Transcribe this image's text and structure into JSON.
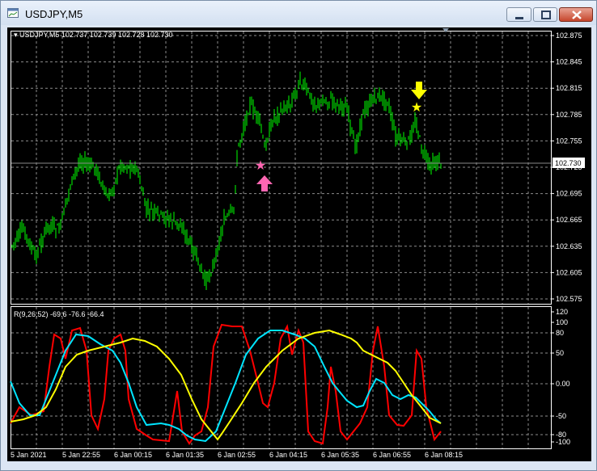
{
  "window": {
    "title": "USDJPY,M5"
  },
  "chart": {
    "header": "USDJPY,M5  102.737 102.739 102.728 102.730",
    "current_price": "102.730",
    "price_ticks": [
      "102.875",
      "102.845",
      "102.815",
      "102.785",
      "102.755",
      "102.725",
      "102.695",
      "102.665",
      "102.635",
      "102.605",
      "102.575"
    ],
    "indicator_header": "R(9,26,52) -69.6 -76.6 -66.4",
    "indicator_ticks": [
      "120",
      "100",
      "80",
      "50",
      "0.00",
      "-50",
      "-80",
      "-100"
    ],
    "time_ticks": [
      "5 Jan 2021",
      "5 Jan 22:55",
      "6 Jan 00:15",
      "6 Jan 01:35",
      "6 Jan 02:55",
      "6 Jan 04:15",
      "6 Jan 05:35",
      "6 Jan 06:55",
      "6 Jan 08:15"
    ],
    "colors": {
      "background": "#000000",
      "candles": "#00ff00",
      "grid": "#ffffff",
      "osc_fast": "#ff0000",
      "osc_mid": "#00e5ff",
      "osc_slow": "#ffff00",
      "buy_signal": "#ff66b2",
      "sell_signal": "#ffff00"
    },
    "signals": [
      {
        "type": "buy",
        "icons": [
          "star-icon",
          "arrow-up-icon"
        ]
      },
      {
        "type": "sell",
        "icons": [
          "star-icon",
          "arrow-down-icon"
        ]
      }
    ]
  }
}
